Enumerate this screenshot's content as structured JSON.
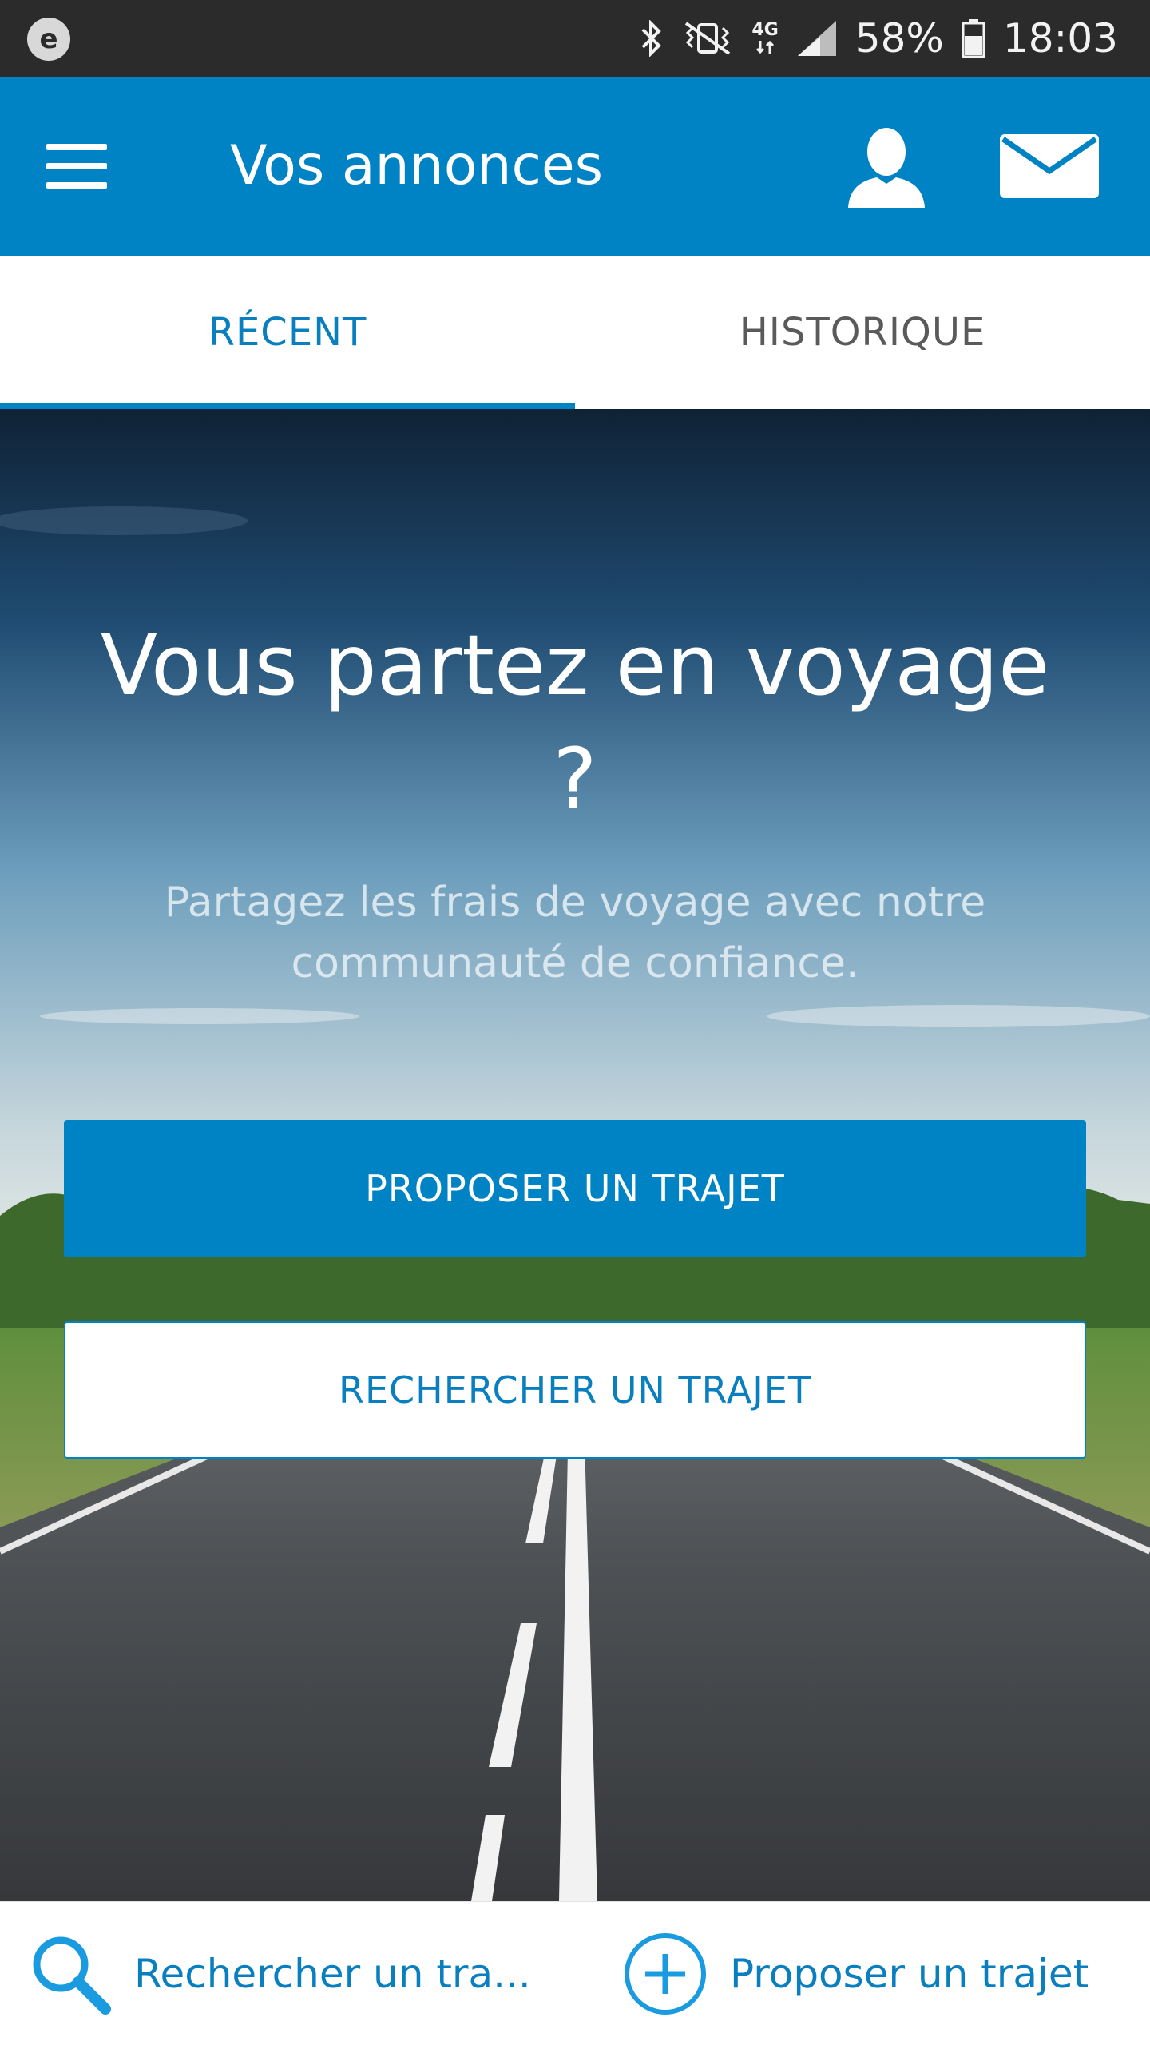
{
  "status_bar": {
    "left_badge": "e",
    "network": "4G",
    "battery": "58%",
    "time": "18:03",
    "icons": [
      "bluetooth-icon",
      "vibrate-icon",
      "signal-icon",
      "battery-icon"
    ]
  },
  "app_bar": {
    "title": "Vos annonces",
    "icons": [
      "menu-icon",
      "user-icon",
      "mail-icon"
    ]
  },
  "tabs": [
    {
      "label": "RÉCENT",
      "active": true
    },
    {
      "label": "HISTORIQUE",
      "active": false
    }
  ],
  "hero": {
    "title": "Vous partez en voyage ?",
    "subtitle": "Partagez les frais de voyage avec notre communauté de confiance.",
    "primary_button": "PROPOSER UN TRAJET",
    "secondary_button": "RECHERCHER UN TRAJET"
  },
  "bottom_bar": {
    "search_label": "Rechercher un tra...",
    "propose_label": "Proposer un trajet",
    "icons": [
      "search-icon",
      "plus-circle-icon"
    ]
  },
  "colors": {
    "primary": "#0083c4",
    "status_bar": "#2b2b2b",
    "white": "#ffffff"
  }
}
